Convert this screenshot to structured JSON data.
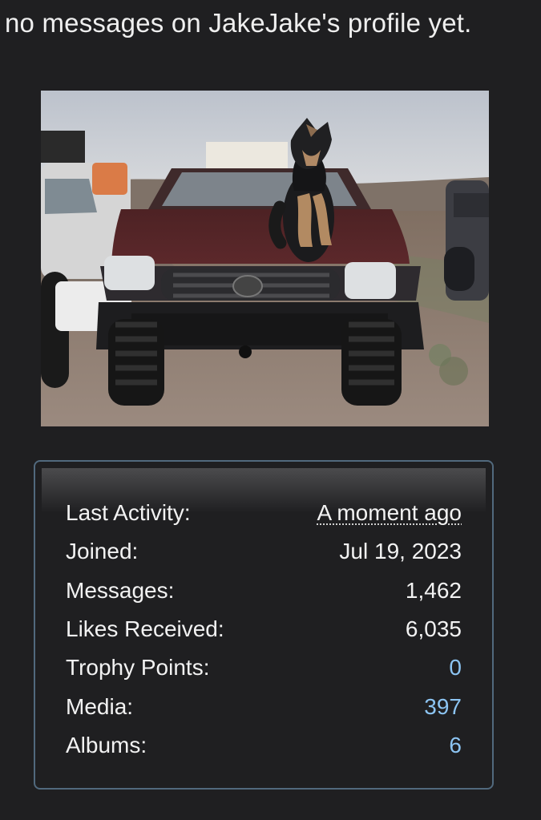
{
  "profile": {
    "empty_messages_text": "no messages on JakeJake's profile yet."
  },
  "photo": {
    "icon": "profile-photo-dog-on-truck"
  },
  "stats": {
    "last_activity_label": "Last Activity:",
    "last_activity_value": "A moment ago",
    "joined_label": "Joined:",
    "joined_value": "Jul 19, 2023",
    "messages_label": "Messages:",
    "messages_value": "1,462",
    "likes_label": "Likes Received:",
    "likes_value": "6,035",
    "trophy_label": "Trophy Points:",
    "trophy_value": "0",
    "media_label": "Media:",
    "media_value": "397",
    "albums_label": "Albums:",
    "albums_value": "6"
  },
  "colors": {
    "background": "#1f1f21",
    "card_border": "#51697d",
    "link": "#8cc4f2",
    "text": "#f2f2f2"
  }
}
